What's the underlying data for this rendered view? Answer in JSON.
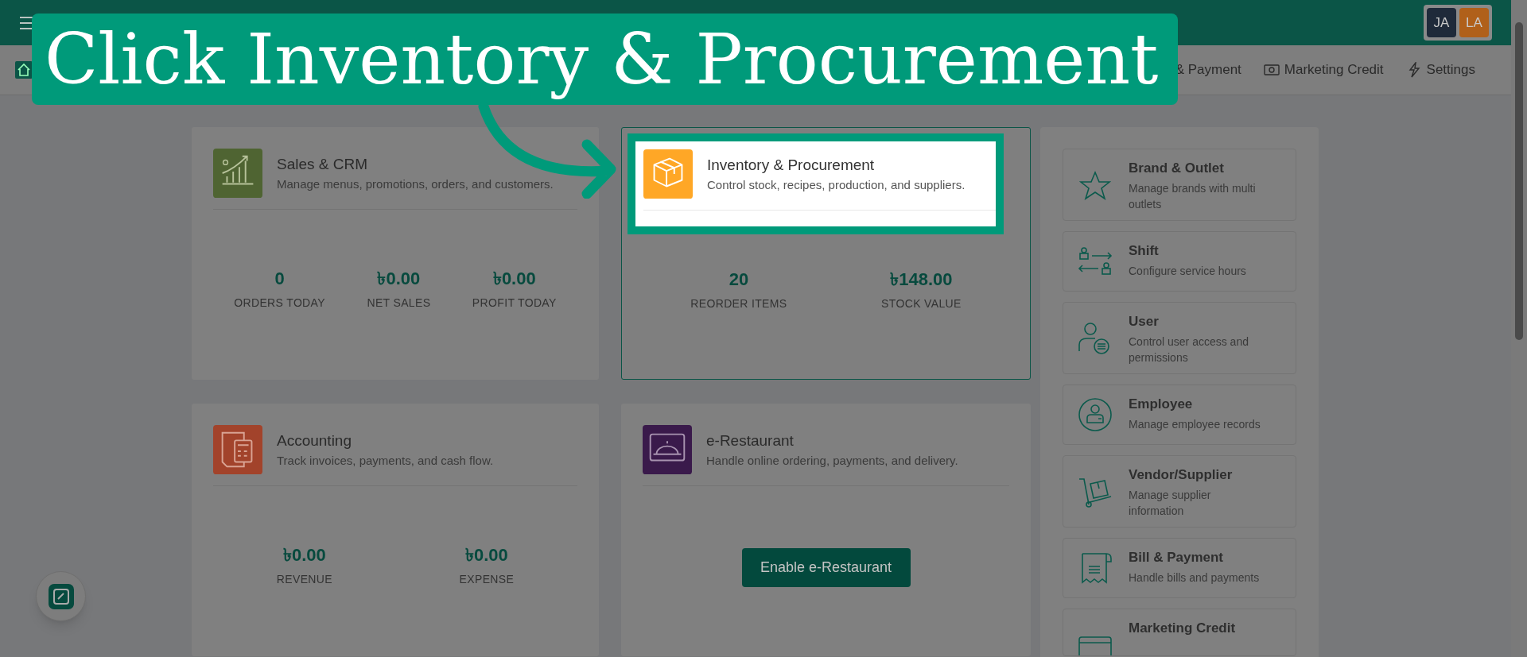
{
  "tutorial": {
    "callout": "Click Inventory & Procurement"
  },
  "header": {
    "avatars": [
      {
        "initials": "JA",
        "color": "#1f2a3a"
      },
      {
        "initials": "LA",
        "color": "#b0601a"
      }
    ]
  },
  "nav": {
    "items": [
      {
        "label": "& Payment"
      },
      {
        "label": "Marketing Credit"
      },
      {
        "label": "Settings"
      }
    ]
  },
  "modules": [
    {
      "title": "Sales & CRM",
      "description": "Manage menus, promotions, orders, and customers.",
      "highlighted": false,
      "stats": [
        {
          "value": "0",
          "label": "ORDERS TODAY"
        },
        {
          "value": "৳0.00",
          "label": "NET SALES"
        },
        {
          "value": "৳0.00",
          "label": "PROFIT TODAY"
        }
      ]
    },
    {
      "title": "Inventory & Procurement",
      "description": "Control stock, recipes, production, and suppliers.",
      "highlighted": true,
      "stats": [
        {
          "value": "20",
          "label": "REORDER ITEMS"
        },
        {
          "value": "৳148.00",
          "label": "STOCK VALUE"
        }
      ]
    },
    {
      "title": "Accounting",
      "description": "Track invoices, payments, and cash flow.",
      "highlighted": false,
      "stats": [
        {
          "value": "৳0.00",
          "label": "REVENUE"
        },
        {
          "value": "৳0.00",
          "label": "EXPENSE"
        }
      ]
    },
    {
      "title": "e-Restaurant",
      "description": "Handle online ordering, payments, and delivery.",
      "highlighted": false,
      "button": "Enable e-Restaurant"
    }
  ],
  "side_items": [
    {
      "title": "Brand & Outlet",
      "description": "Manage brands with multi outlets"
    },
    {
      "title": "Shift",
      "description": "Configure service hours"
    },
    {
      "title": "User",
      "description": "Control user access and permissions"
    },
    {
      "title": "Employee",
      "description": "Manage employee records"
    },
    {
      "title": "Vendor/Supplier",
      "description": "Manage supplier information"
    },
    {
      "title": "Bill & Payment",
      "description": "Handle bills and payments"
    },
    {
      "title": "Marketing Credit"
    }
  ]
}
